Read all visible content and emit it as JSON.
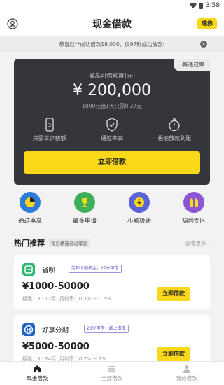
{
  "status": {
    "time": "3:58"
  },
  "header": {
    "title": "现金借款",
    "vip_label": "速券"
  },
  "notice": {
    "text": "恭喜赵**成功借款18,000，仅97秒成功放款!"
  },
  "card": {
    "badge": "高通过率",
    "amount_label": "最高可借额度(元)",
    "amount": "¥ 200,000",
    "amount_sub": "1000元借1天只需0.27元",
    "features": [
      {
        "icon": "phone-icon",
        "label": "只需三步获额"
      },
      {
        "icon": "shield-check-icon",
        "label": "通过率高"
      },
      {
        "icon": "stopwatch-icon",
        "label": "极速放款到账"
      }
    ],
    "borrow_label": "立即借款"
  },
  "quick_links": [
    {
      "icon": "gauge-icon",
      "label": "通过率高",
      "color": "#2f7bd9"
    },
    {
      "icon": "trophy-icon",
      "label": "最多申请",
      "color": "#3fae5a"
    },
    {
      "icon": "lightning-icon",
      "label": "小额极速",
      "color": "#5a63d9"
    },
    {
      "icon": "gift-icon",
      "label": "福利专区",
      "color": "#8a56d6"
    }
  ],
  "hot": {
    "title": "热门推荐",
    "tag": "每日精选通过率高",
    "more": "查看更多 ›"
  },
  "products": [
    {
      "name": "省呗",
      "tag": "劳扣大额机金，22岁可借",
      "range": "¥1000-50000",
      "desc": "期限：3 - 12月, 月利率：0.3% ~ 0.5%",
      "button": "立即借款",
      "logo_color": "#2bb673"
    },
    {
      "name": "好享分期",
      "tag": "23岁可借，线上审批",
      "range": "¥5000-50000",
      "desc": "期限：3 - 24月, 月利率：0.7% ~ 2%",
      "button": "立即借款",
      "logo_color": "#1e63c6"
    }
  ],
  "tabbar": [
    {
      "icon": "home-icon",
      "label": "现金借款",
      "active": true
    },
    {
      "icon": "list-icon",
      "label": "全部借款",
      "active": false
    },
    {
      "icon": "person-icon",
      "label": "我的借款",
      "active": false
    }
  ],
  "colors": {
    "accent": "#f9d81a",
    "card_bg": "#34363c"
  }
}
